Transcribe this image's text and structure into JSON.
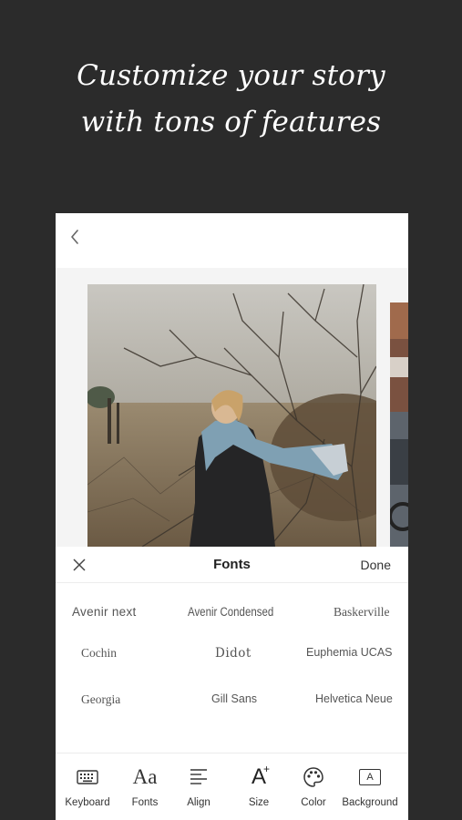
{
  "headline": {
    "line1": "Customize your story",
    "line2": "with tons of features"
  },
  "editor": {
    "back_icon": "chevron-left-icon"
  },
  "font_sheet": {
    "title": "Fonts",
    "done_label": "Done",
    "close_icon": "close-icon",
    "fonts": [
      "Avenir next",
      "Avenir Condensed",
      "Baskerville",
      "Cochin",
      "Didot",
      "Euphemia  UCAS",
      "Georgia",
      "Gill Sans",
      "Helvetica Neue"
    ]
  },
  "toolbar": {
    "items": [
      {
        "label": "Keyboard",
        "icon": "keyboard-icon"
      },
      {
        "label": "Fonts",
        "icon": "fonts-icon",
        "glyph": "Aa"
      },
      {
        "label": "Align",
        "icon": "align-icon"
      },
      {
        "label": "Size",
        "icon": "size-icon",
        "glyph": "A"
      },
      {
        "label": "Color",
        "icon": "palette-icon"
      },
      {
        "label": "Background",
        "icon": "background-icon",
        "glyph": "A"
      }
    ]
  }
}
